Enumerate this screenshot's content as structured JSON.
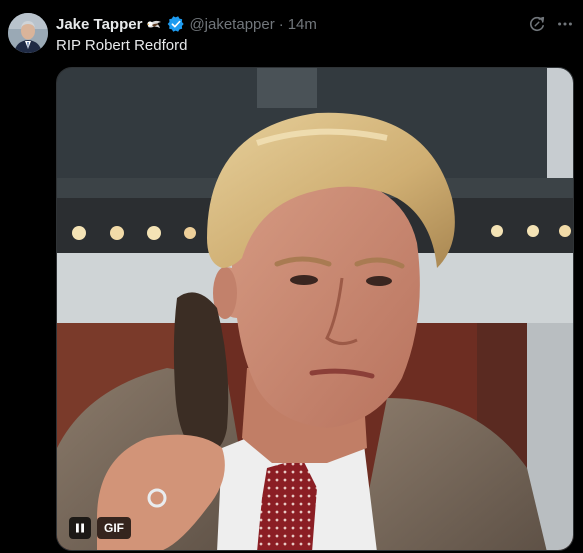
{
  "tweet": {
    "author_name": "Jake Tapper",
    "handle": "@jaketapper",
    "separator": "·",
    "time": "14m",
    "text": "RIP Robert Redford",
    "badges": [
      "eagle-emoji",
      "verified-badge"
    ]
  },
  "actions": {
    "grok_icon": "grok-icon",
    "more_icon": "more-icon"
  },
  "media": {
    "type": "gif",
    "gif_label": "GIF",
    "playback_state": "playing",
    "pause_icon": "pause-icon"
  },
  "colors": {
    "background": "#000000",
    "text_primary": "#e7e9ea",
    "text_secondary": "#71767b",
    "verified_blue": "#1d9bf0"
  }
}
